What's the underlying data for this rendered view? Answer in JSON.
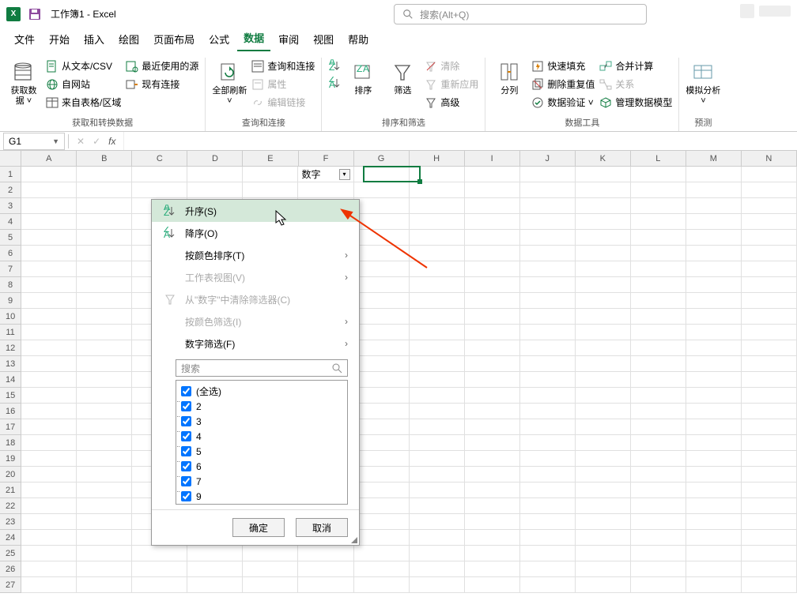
{
  "title": "工作簿1 - Excel",
  "search_placeholder": "搜索(Alt+Q)",
  "menu": {
    "tabs": [
      "文件",
      "开始",
      "插入",
      "绘图",
      "页面布局",
      "公式",
      "数据",
      "审阅",
      "视图",
      "帮助"
    ],
    "active": 6
  },
  "ribbon": {
    "g1": {
      "label": "获取和转换数据",
      "getdata": "获取数\n据 ˅",
      "csv": "从文本/CSV",
      "web": "自网站",
      "range": "来自表格/区域",
      "recent": "最近使用的源",
      "conn": "现有连接"
    },
    "g2": {
      "label": "查询和连接",
      "refresh": "全部刷新\n˅",
      "qc": "查询和连接",
      "prop": "属性",
      "edit": "编辑链接"
    },
    "g3": {
      "label": "排序和筛选",
      "sort": "排序",
      "filter": "筛选",
      "clear": "清除",
      "reapply": "重新应用",
      "adv": "高级"
    },
    "g4": {
      "label": "数据工具",
      "split": "分列",
      "flash": "快速填充",
      "dedup": "删除重复值",
      "valid": "数据验证 ˅",
      "cons": "合并计算",
      "rel": "关系",
      "model": "管理数据模型"
    },
    "g5": {
      "label": "预测",
      "whatif": "模拟分析\n˅"
    }
  },
  "namebox": "G1",
  "columns": [
    "A",
    "B",
    "C",
    "D",
    "E",
    "F",
    "G",
    "H",
    "I",
    "J",
    "K",
    "L",
    "M",
    "N"
  ],
  "row_count": 27,
  "filter_header_cell": "数字",
  "filter_menu": {
    "asc": "升序(S)",
    "desc": "降序(O)",
    "bycolor_sort": "按颜色排序(T)",
    "sheetview": "工作表视图(V)",
    "clearfilter": "从\"数字\"中清除筛选器(C)",
    "bycolor_filter": "按颜色筛选(I)",
    "numfilter": "数字筛选(F)",
    "search_ph": "搜索",
    "items": [
      "(全选)",
      "2",
      "3",
      "4",
      "5",
      "6",
      "7",
      "9"
    ],
    "ok": "确定",
    "cancel": "取消"
  }
}
